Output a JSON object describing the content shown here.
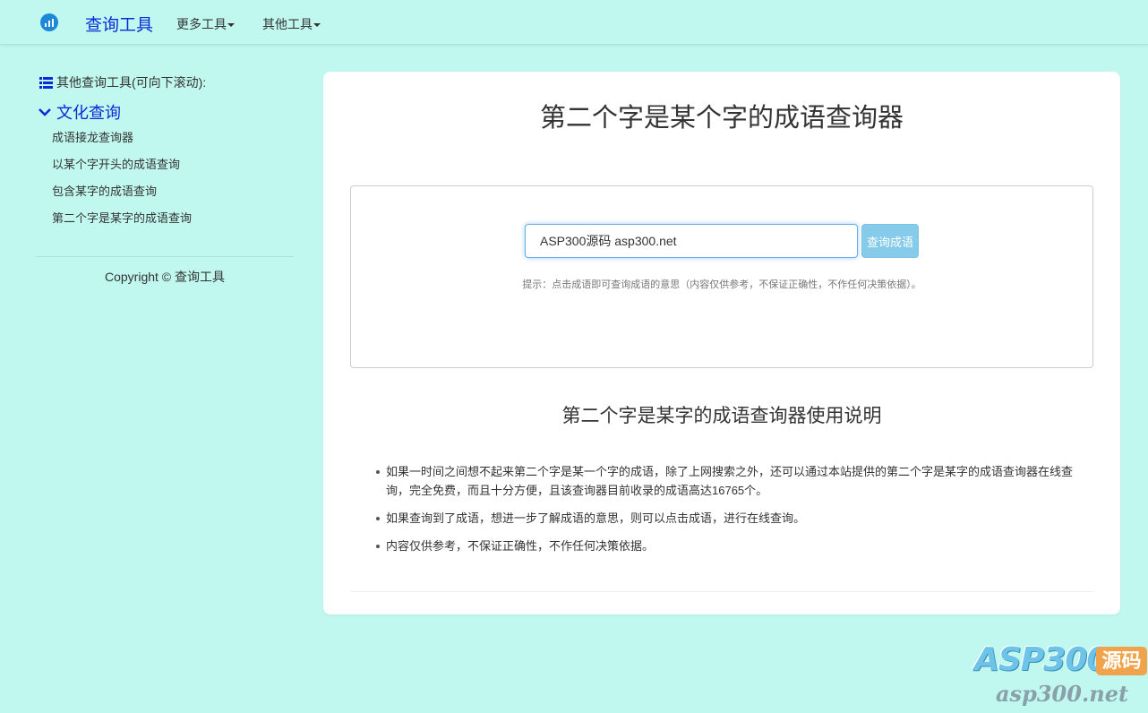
{
  "navbar": {
    "brand": "查询工具",
    "menus": [
      "更多工具",
      "其他工具"
    ]
  },
  "sidebar": {
    "header": "其他查询工具(可向下滚动):",
    "category": "文化查询",
    "items": [
      "成语接龙查询器",
      "以某个字开头的成语查询",
      "包含某字的成语查询",
      "第二个字是某字的成语查询"
    ],
    "copyright": "Copyright © 查询工具"
  },
  "main": {
    "title": "第二个字是某个字的成语查询器",
    "search": {
      "value": "ASP300源码 asp300.net",
      "button": "查询成语",
      "hint": "提示：点击成语即可查询成语的意思（内容仅供参考，不保证正确性，不作任何决策依据）。"
    },
    "usage_title": "第二个字是某字的成语查询器使用说明",
    "bullets": [
      "如果一时间之间想不起来第二个字是某一个字的成语，除了上网搜索之外，还可以通过本站提供的第二个字是某字的成语查询器在线查询，完全免费，而且十分方便，且该查询器目前收录的成语高达16765个。",
      "如果查询到了成语，想进一步了解成语的意思，则可以点击成语，进行在线查询。",
      "内容仅供参考，不保证正确性，不作任何决策依据。"
    ]
  },
  "watermark": {
    "main": "ASP300",
    "badge": "源码",
    "sub": "asp300.net"
  },
  "colors": {
    "background": "#c0f8ef",
    "brand": "#0a2bd6",
    "button": "#86cbe9"
  }
}
